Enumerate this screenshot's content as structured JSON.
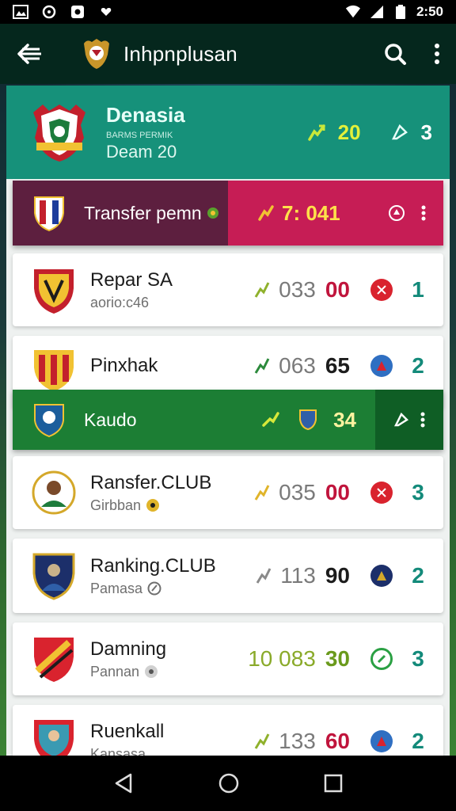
{
  "status_bar": {
    "time": "2:50",
    "icons": [
      "screenshot-icon",
      "sync-icon",
      "photo-icon",
      "heart-icon",
      "wifi-icon",
      "signal-icon",
      "battery-icon"
    ]
  },
  "app_bar": {
    "title": "Inhpnplusan",
    "icons": [
      "back-arrow-icon",
      "club-logo-icon",
      "search-icon",
      "more-vert-icon"
    ]
  },
  "header_card": {
    "title": "Denasia",
    "tiny_text": "BARMS PERMIK",
    "subtitle": "Deam 20",
    "score": "20",
    "rank": "3",
    "color": "#16917a"
  },
  "transfer_banner": {
    "label": "Transfer pemn",
    "score": "7: 041",
    "left_color": "#5d1f3f",
    "right_color": "#c61d55"
  },
  "kaudo_banner": {
    "label": "Kaudo",
    "score": "34",
    "color": "#1c7e34"
  },
  "rows": [
    {
      "name": "Repar SA",
      "sub": "aorio:c46",
      "num1": "033",
      "num2": "00",
      "num2_color": "#c0143c",
      "badge_color": "#d9232e",
      "rank": "1"
    },
    {
      "name": "Pinxhak",
      "sub": "",
      "num1": "063",
      "num2": "65",
      "num2_color": "#1c1c1c",
      "badge_color": "#2f6fc2",
      "rank": "2"
    },
    {
      "name": "Ransfer.CLUB",
      "sub": "Girbban",
      "num1": "035",
      "num2": "00",
      "num2_color": "#c0143c",
      "badge_color": "#d9232e",
      "rank": "3"
    },
    {
      "name": "Ranking.CLUB",
      "sub": "Pamasa",
      "num1": "113",
      "num2": "90",
      "num2_color": "#1c1c1c",
      "badge_color": "#1c2f6a",
      "rank": "2"
    },
    {
      "name": "Damning",
      "sub": "Pannan",
      "num1": "10 083",
      "num2": "30",
      "num2_color": "#6a9a1c",
      "badge_color": "#2aa043",
      "rank": "3"
    },
    {
      "name": "Ruenkall",
      "sub": "Kansasa",
      "num1": "133",
      "num2": "60",
      "num2_color": "#c0143c",
      "badge_color": "#2f6fc2",
      "rank": "2"
    }
  ],
  "nav_bar": {
    "icons": [
      "nav-back-icon",
      "nav-home-icon",
      "nav-recents-icon"
    ]
  }
}
